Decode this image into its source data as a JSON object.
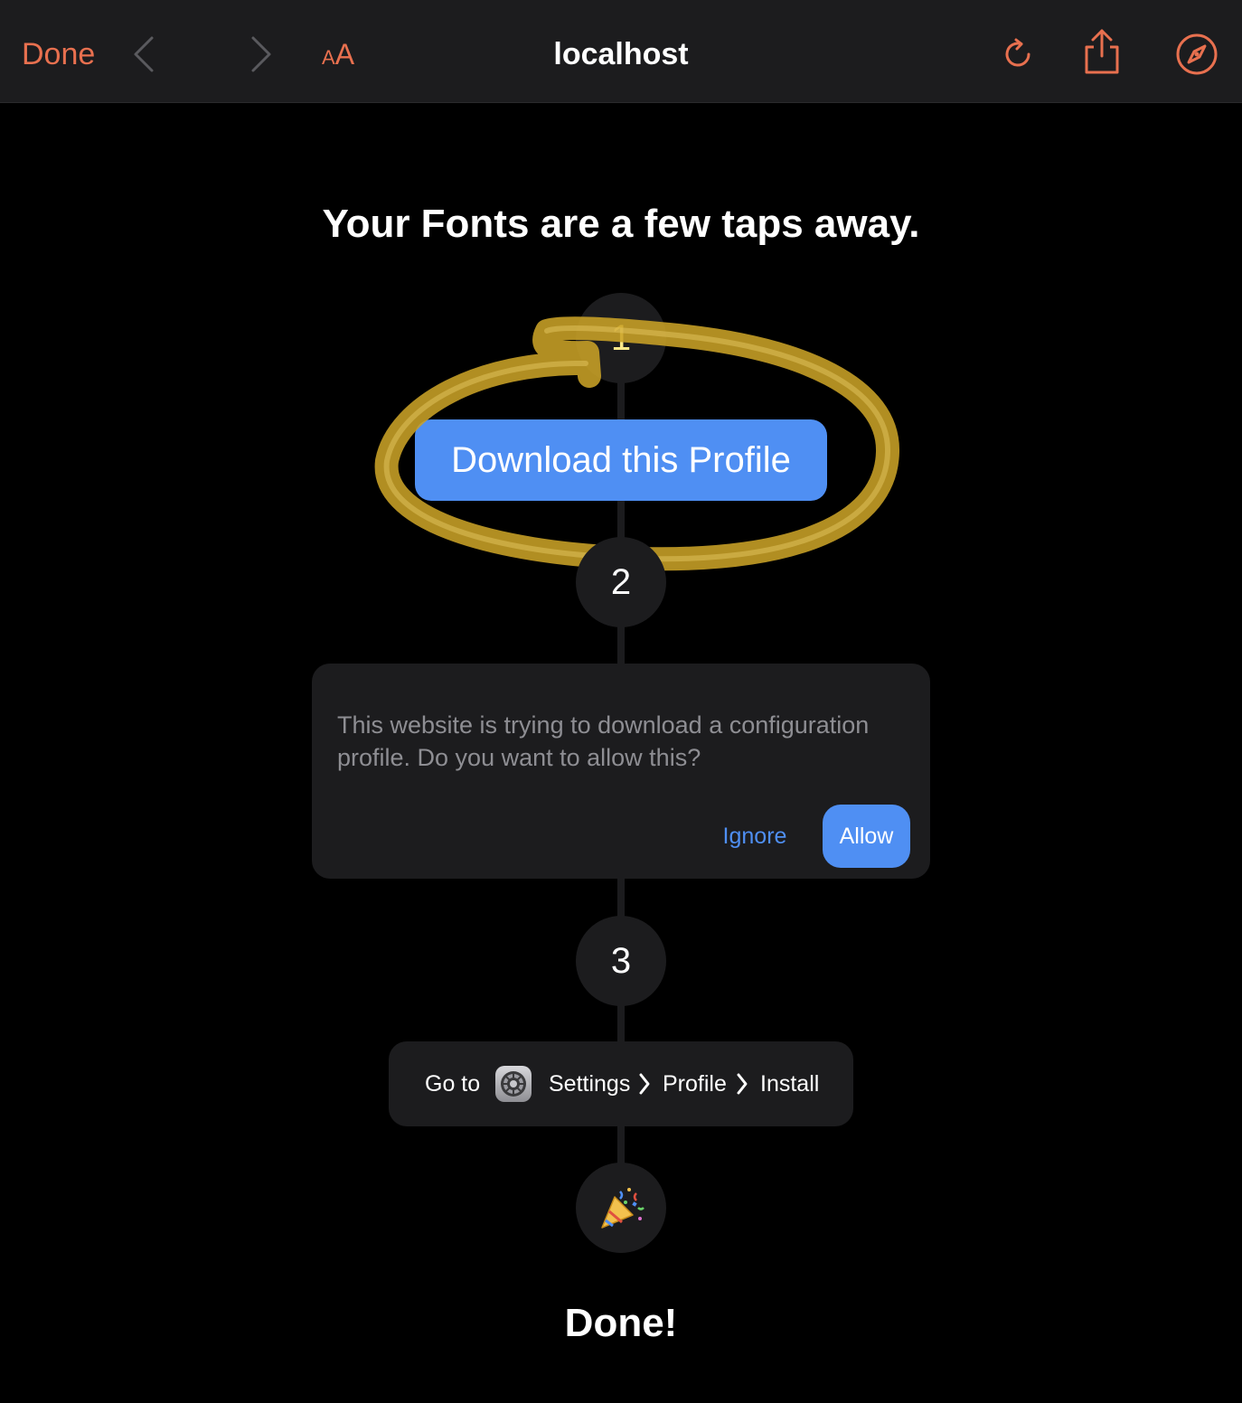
{
  "toolbar": {
    "done_label": "Done",
    "aa_small": "A",
    "aa_big": "A",
    "title": "localhost",
    "accent_color": "#e8704f"
  },
  "main": {
    "headline": "Your Fonts are a few taps away.",
    "steps": [
      "1",
      "2",
      "3"
    ],
    "download_button": "Download this Profile",
    "dialog": {
      "message": "This website is trying to download a configuration profile. Do you want to allow this?",
      "ignore_label": "Ignore",
      "allow_label": "Allow"
    },
    "goto": {
      "prefix": "Go to",
      "settings": "Settings",
      "profile": "Profile",
      "install": "Install"
    },
    "done_label": "Done!",
    "button_color": "#4f8ff3",
    "annotation_color": "#c9a227"
  }
}
